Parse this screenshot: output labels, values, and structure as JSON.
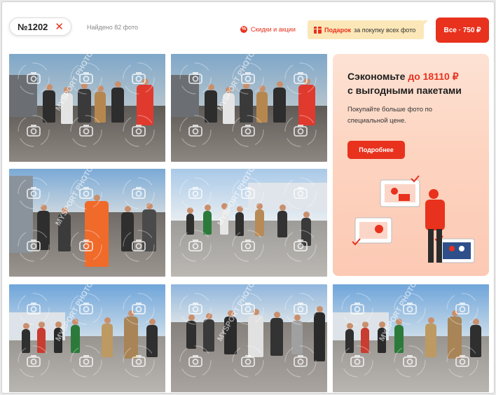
{
  "filter_chip": {
    "label": "№1202",
    "remove_icon": "close-icon"
  },
  "found_text": "Найдено 82 фото",
  "discounts": {
    "label": "Скидки и акции",
    "icon": "percent-icon"
  },
  "gift_banner": {
    "strong": "Подарок",
    "text": "за покупку всех фото",
    "icon": "gift-icon"
  },
  "buy_all": {
    "label": "Все · 750 ₽"
  },
  "promo": {
    "title_start": "Сэкономьте ",
    "title_accent": "до 18110 ₽",
    "title_end": "с выгодными пакетами",
    "text": "Покупайте больше фото по специальной цене.",
    "button": "Подробнее"
  },
  "watermark_text": "MYSPORT PHOTO",
  "colors": {
    "accent": "#e8321e",
    "gift_bg": "#fbe7b8",
    "promo_bg": "#fdd8c6"
  },
  "photos": [
    {
      "name": "photo-1",
      "scene": "crowd-warm"
    },
    {
      "name": "photo-2",
      "scene": "crowd-warm"
    },
    {
      "name": "photo-3",
      "scene": "orange-runner"
    },
    {
      "name": "photo-4",
      "scene": "stadium-bright"
    },
    {
      "name": "photo-5",
      "scene": "stadium-blue"
    },
    {
      "name": "photo-6",
      "scene": "road-group"
    },
    {
      "name": "photo-7",
      "scene": "stadium-blue"
    }
  ]
}
